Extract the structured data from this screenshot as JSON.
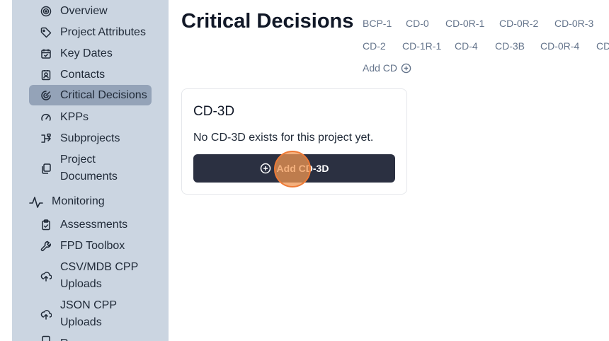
{
  "sidebar": {
    "items": [
      {
        "label": "Overview",
        "icon": "target-icon"
      },
      {
        "label": "Project Attributes",
        "icon": "tag-icon"
      },
      {
        "label": "Key Dates",
        "icon": "calendar-icon"
      },
      {
        "label": "Contacts",
        "icon": "contact-card-icon"
      },
      {
        "label": "Critical Decisions",
        "icon": "radar-icon",
        "active": true
      },
      {
        "label": "KPPs",
        "icon": "gauge-icon"
      },
      {
        "label": "Subprojects",
        "icon": "branch-icon"
      },
      {
        "label_line1": "Project",
        "label_line2": "Documents",
        "icon": "copy-icon"
      }
    ],
    "monitoring": {
      "title": "Monitoring",
      "icon": "activity-icon",
      "items": [
        {
          "label": "Assessments",
          "icon": "clipboard-check-icon"
        },
        {
          "label": "FPD Toolbox",
          "icon": "wrench-icon"
        },
        {
          "label_line1": "CSV/MDB CPP",
          "label_line2": "Uploads",
          "icon": "cloud-upload-icon"
        },
        {
          "label_line1": "JSON CPP",
          "label_line2": "Uploads",
          "icon": "cloud-upload-icon"
        },
        {
          "label": "R",
          "icon": "document-icon"
        }
      ]
    }
  },
  "main": {
    "title": "Critical Decisions",
    "cd_links_row1": [
      "BCP-1",
      "CD-0",
      "CD-0R-1",
      "CD-0R-2",
      "CD-0R-3"
    ],
    "cd_links_row2": [
      "CD-2",
      "CD-1R-1",
      "CD-4",
      "CD-3B",
      "CD-0R-4",
      "CD"
    ],
    "add_cd_label": "Add CD",
    "card": {
      "title": "CD-3D",
      "message": "No CD-3D exists for this project yet.",
      "button_label": "Add CD-3D"
    }
  },
  "colors": {
    "sidebar_bg": "#cbd5e1",
    "active_bg": "#94a3b8",
    "button_bg": "#2b3041",
    "link_color": "#64748b",
    "click_indicator": "#f09552"
  }
}
